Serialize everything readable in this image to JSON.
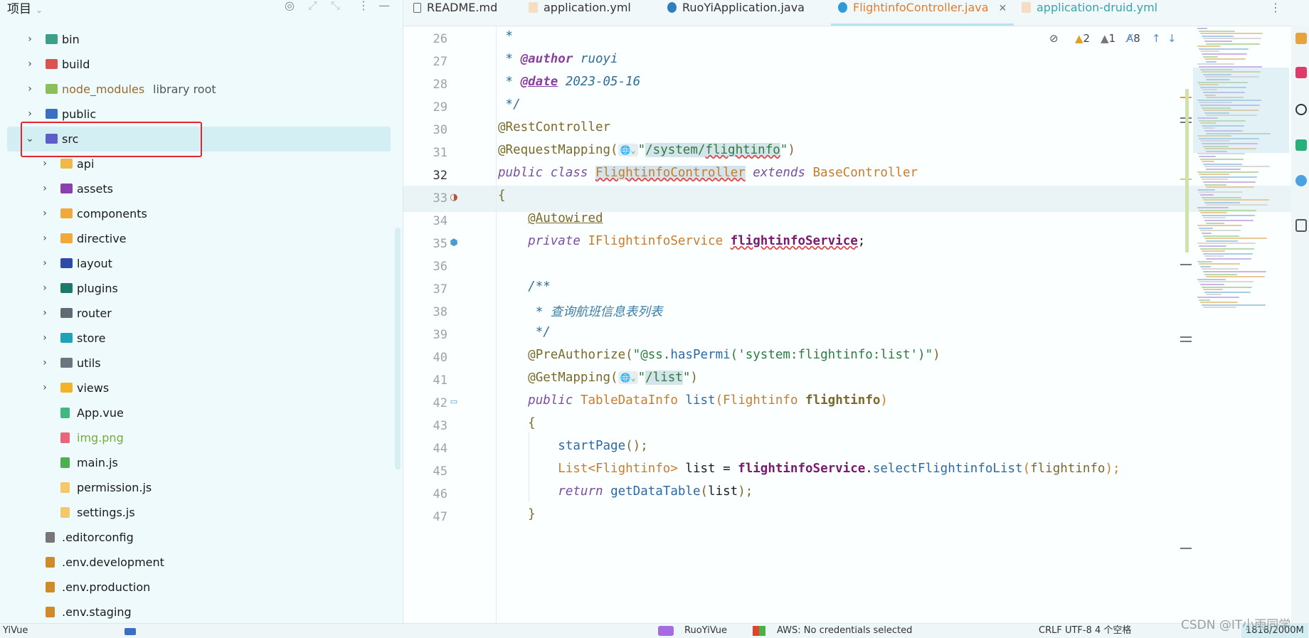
{
  "project_panel": {
    "title": "项目",
    "items": [
      {
        "label": "bin",
        "icon": "folder-icon",
        "color": "#3d9e8a"
      },
      {
        "label": "build",
        "icon": "folder-icon",
        "color": "#d9534f"
      },
      {
        "label": "node_modules",
        "suffix": "library root",
        "icon": "folder-icon",
        "color": "#8bbf5a"
      },
      {
        "label": "public",
        "icon": "folder-icon",
        "color": "#3b6fc6"
      },
      {
        "label": "src",
        "icon": "folder-icon",
        "color": "#5b5fc7"
      },
      {
        "label": "api",
        "icon": "folder-icon",
        "color": "#f0b84a"
      },
      {
        "label": "assets",
        "icon": "folder-icon",
        "color": "#8c3fb0"
      },
      {
        "label": "components",
        "icon": "folder-icon",
        "color": "#f0a93a"
      },
      {
        "label": "directive",
        "icon": "folder-icon",
        "color": "#f0a93a"
      },
      {
        "label": "layout",
        "icon": "folder-icon",
        "color": "#2f4aa8"
      },
      {
        "label": "plugins",
        "icon": "folder-icon",
        "color": "#1d7a6a"
      },
      {
        "label": "router",
        "icon": "folder-icon",
        "color": "#5e6b75"
      },
      {
        "label": "store",
        "icon": "folder-icon",
        "color": "#1fa3b8"
      },
      {
        "label": "utils",
        "icon": "folder-icon",
        "color": "#6b757d"
      },
      {
        "label": "views",
        "icon": "folder-icon",
        "color": "#f0b32a"
      },
      {
        "label": "App.vue",
        "icon": "vue-file-icon",
        "color": "#41b883"
      },
      {
        "label": "img.png",
        "icon": "image-file-icon",
        "color": "#e8657a"
      },
      {
        "label": "main.js",
        "icon": "js-file-icon",
        "color": "#4caf50"
      },
      {
        "label": "permission.js",
        "icon": "js-file-icon",
        "color": "#f3c76a"
      },
      {
        "label": "settings.js",
        "icon": "js-file-icon",
        "color": "#f3c76a"
      },
      {
        "label": ".editorconfig",
        "icon": "config-file-icon",
        "color": "#777777"
      },
      {
        "label": ".env.development",
        "icon": "env-file-icon",
        "color": "#d08a2a"
      },
      {
        "label": ".env.production",
        "icon": "env-file-icon",
        "color": "#d08a2a"
      },
      {
        "label": ".env.staging",
        "icon": "env-file-icon",
        "color": "#d08a2a"
      }
    ]
  },
  "tabs": [
    {
      "label": "README.md",
      "color": "#333333"
    },
    {
      "label": "application.yml",
      "color": "#333333"
    },
    {
      "label": "RuoYiApplication.java",
      "color": "#333333"
    },
    {
      "label": "FlightinfoController.java",
      "color": "#e07d2b"
    },
    {
      "label": "application-druid.yml",
      "color": "#3aa4a8"
    }
  ],
  "inspection": {
    "warnings": "2",
    "weak_warnings": "1",
    "typos": "8"
  },
  "editor": {
    "line_numbers": [
      "26",
      "27",
      "28",
      "29",
      "30",
      "31",
      "32",
      "33",
      "34",
      "35",
      "36",
      "37",
      "38",
      "39",
      "40",
      "41",
      "42",
      "43",
      "44",
      "45",
      "46",
      "47"
    ],
    "current_line": "32"
  },
  "status_bar": {
    "left": "YiVue",
    "project": "RuoYiVue",
    "aws": "AWS: No credentials selected",
    "right": "CRLF  UTF-8  4 个空格",
    "position": "1818/2000M"
  },
  "watermark": "CSDN @IT小雨同学"
}
